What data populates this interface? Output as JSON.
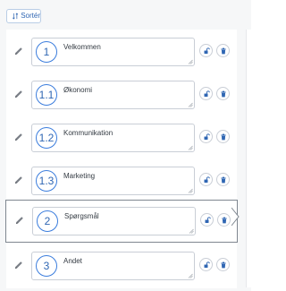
{
  "toolbar": {
    "sort_label": "Sortér",
    "sort_icon": "sort-icon"
  },
  "colors": {
    "accent": "#2f66b3",
    "circle_border": "#3b7ddd",
    "field_border": "#c9ced6",
    "selected_border": "#7f8790",
    "background": "#f6f7f8"
  },
  "items": [
    {
      "number": "1",
      "title": "Velkommen",
      "selected": false
    },
    {
      "number": "1.1",
      "title": "Økonomi",
      "selected": false
    },
    {
      "number": "1.2",
      "title": "Kommunikation",
      "selected": false
    },
    {
      "number": "1.3",
      "title": "Marketing",
      "selected": false
    },
    {
      "number": "2",
      "title": "Spørgsmål",
      "selected": true
    },
    {
      "number": "3",
      "title": "Andet",
      "selected": false
    }
  ],
  "icons": {
    "edit": "pencil-icon",
    "lock": "lock-icon",
    "delete": "trash-icon"
  }
}
